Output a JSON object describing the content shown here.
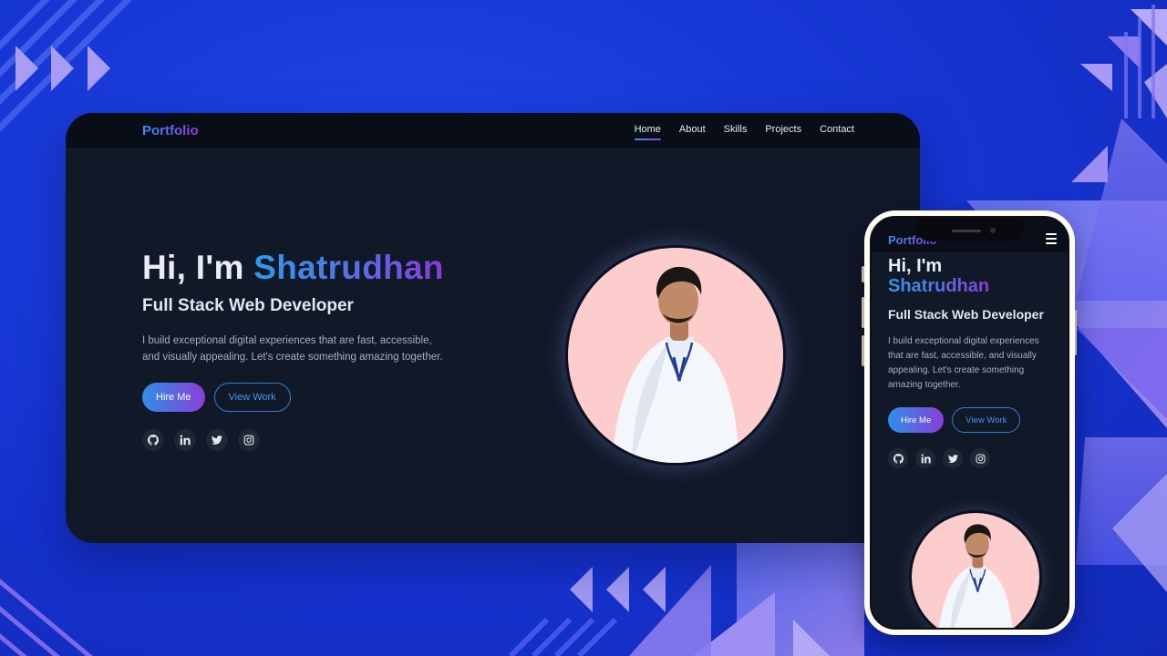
{
  "colors": {
    "page_background": "#1537d6",
    "card_background": "#111827",
    "navbar_background": "#090d17",
    "accent_gradient_start": "#2d9be8",
    "accent_gradient_end": "#8a3ad8",
    "photo_background": "#fdcccd",
    "phone_frame": "#fdfbf2"
  },
  "desktop": {
    "brand": "Portfolio",
    "nav": [
      {
        "label": "Home",
        "active": true
      },
      {
        "label": "About",
        "active": false
      },
      {
        "label": "Skills",
        "active": false
      },
      {
        "label": "Projects",
        "active": false
      },
      {
        "label": "Contact",
        "active": false
      }
    ],
    "hero": {
      "greeting": "Hi, I'm",
      "name": "Shatrudhan",
      "role": "Full Stack Web Developer",
      "description": "I build exceptional digital experiences that are fast, accessible, and visually appealing. Let's create something amazing together.",
      "primary_button": "Hire Me",
      "secondary_button": "View Work"
    },
    "social_icons": [
      "github-icon",
      "linkedin-icon",
      "twitter-icon",
      "instagram-icon"
    ]
  },
  "mobile": {
    "brand": "Portfolio",
    "menu_icon": "hamburger-menu-icon",
    "hero": {
      "greeting": "Hi, I'm",
      "name": "Shatrudhan",
      "role": "Full Stack Web Developer",
      "description": "I build exceptional digital experiences that are fast, accessible, and visually appealing. Let's create something amazing together.",
      "primary_button": "Hire Me",
      "secondary_button": "View Work"
    },
    "social_icons": [
      "github-icon",
      "linkedin-icon",
      "twitter-icon",
      "instagram-icon"
    ]
  }
}
